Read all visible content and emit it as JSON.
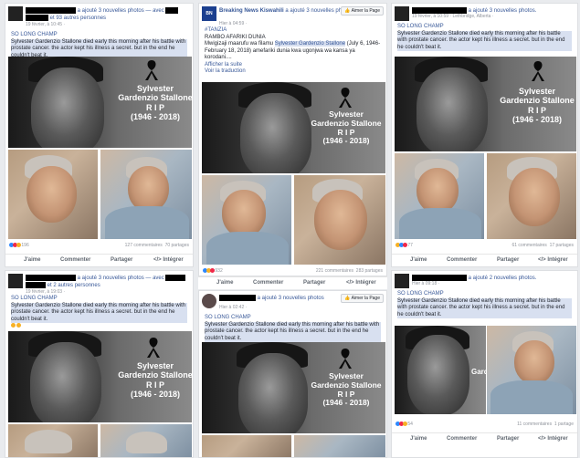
{
  "common": {
    "added_photos_3": "a ajouté 3 nouvelles photos.",
    "added_photos_2": "a ajouté 2 nouvelles photos.",
    "added_photos_3b": "a ajouté 3 nouvelles photos",
    "with": "— avec",
    "headline": "SO LONG CHAMP",
    "body": "Sylvester Gardenzio Stallone died early this morning after his battle with prostate cancer.  the actor kept his illness a secret.  but in the end he couldn't beat it.",
    "rip_name1": "Sylvester",
    "rip_name2": "Gardenzio Stallone",
    "rip_rip": "R I P",
    "rip_years": "(1946 - 2018)",
    "like": "J'aime",
    "comment": "Commenter",
    "share": "Partager",
    "embed": "</> Intégrer",
    "like_page": "Aimer la Page"
  },
  "posts": {
    "p1": {
      "others": "et 93 autres personnes",
      "time": "19 février, à 10:45 · ",
      "reactions": "196",
      "comments": "127 commentaires",
      "shares": "70 partages"
    },
    "p2": {
      "page": "Breaking News Kiswahili",
      "time": "Hier à 04:59 · ",
      "hashtag": "#TANZIA",
      "title": "RAMBO AFARIKI DUNIA",
      "text_a": "Mwigizaji maarufu wa filamu ",
      "text_link": "Sylvester Gardenzio Stallone",
      "text_b": " (July 6, 1946- February 18, 2018) amefariki dunia kwa ugonjwa wa kansa ya korodani....",
      "more": "Afficher la suite",
      "translate": "Voir la traduction",
      "reactions": "932",
      "comments": "221 commentaires",
      "shares": "283 partages"
    },
    "p3": {
      "time": "19 février, à 10:59 · Lethbridge, Alberta · ",
      "reactions": "77",
      "comments": "61 commentaires",
      "shares": "17 partages"
    },
    "p4": {
      "others": "et 2 autres personnes",
      "time": "19 février, à 19:03 · "
    },
    "p5": {
      "time": "Hier à 02:42 · "
    },
    "p6": {
      "time": "Hier à 09:18 · ",
      "reactions": "54",
      "comments": "11 commentaires",
      "shares": "1 partage"
    }
  },
  "colors": {
    "like_blue": "#2d88ff",
    "love_red": "#f0284a",
    "haha_yellow": "#f7b125",
    "link": "#385898"
  }
}
